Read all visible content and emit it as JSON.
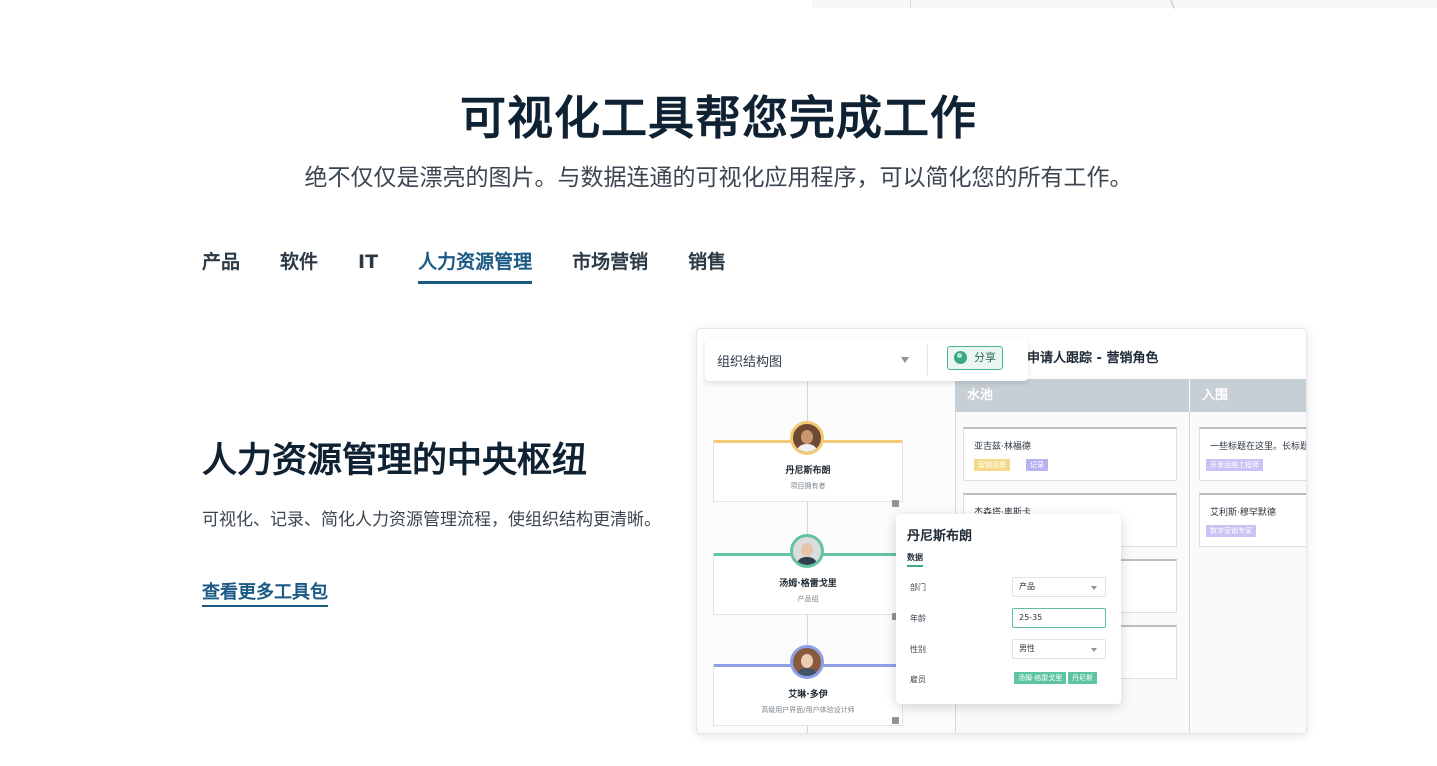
{
  "hero": {
    "title": "可视化工具帮您完成工作",
    "subtitle": "绝不仅仅是漂亮的图片。与数据连通的可视化应用程序，可以简化您的所有工作。"
  },
  "tabs": [
    "产品",
    "软件",
    "IT",
    "人力资源管理",
    "市场营销",
    "销售"
  ],
  "active_tab": "人力资源管理",
  "feature": {
    "title": "人力资源管理的中央枢纽",
    "description": "可视化、记录、简化人力资源管理流程，使组织结构更清晰。",
    "link": "查看更多工具包"
  },
  "mock": {
    "board_title": "申请人跟踪 - 营销角色",
    "selector_label": "组织结构图",
    "share_label": "分享",
    "org_nodes": [
      {
        "name": "丹尼斯布朗",
        "role": "项目拥有者",
        "color": "#f3c975"
      },
      {
        "name": "汤姆·格雷戈里",
        "role": "产品组",
        "color": "#66c2a5"
      },
      {
        "name": "艾琳·多伊",
        "role": "高级用户界面/用户体验设计师",
        "color": "#8f9fe8"
      }
    ],
    "columns": [
      {
        "header": "水池",
        "cards": [
          {
            "title": "亚吉兹·林福德",
            "tags": [
              {
                "text": "营销背景",
                "color": "#f6d98a"
              },
              {
                "text": "记录",
                "color": "#b7b2f0"
              }
            ]
          },
          {
            "title": "杰森塔·奥斯卡",
            "tags": []
          },
          {
            "title": "",
            "tags": []
          },
          {
            "title": "",
            "tags": []
          }
        ]
      },
      {
        "header": "入围",
        "cards": [
          {
            "title": "一些标题在这里。长标题",
            "tags": [
              {
                "text": "开发运维工程师",
                "color": "#c9c2f4"
              }
            ]
          },
          {
            "title": "艾利斯·穆罕默德",
            "tags": [
              {
                "text": "数字营销专家",
                "color": "#c9c2f4"
              }
            ]
          }
        ]
      }
    ],
    "popup": {
      "name": "丹尼斯布朗",
      "tab": "数据",
      "fields": [
        {
          "label": "部门",
          "value": "产品",
          "type": "select"
        },
        {
          "label": "年龄",
          "value": "25-35",
          "type": "input"
        },
        {
          "label": "性别",
          "value": "男性",
          "type": "select"
        },
        {
          "label": "雇员",
          "chips": [
            "汤姆·格雷戈里",
            "丹尼斯"
          ]
        }
      ]
    }
  }
}
